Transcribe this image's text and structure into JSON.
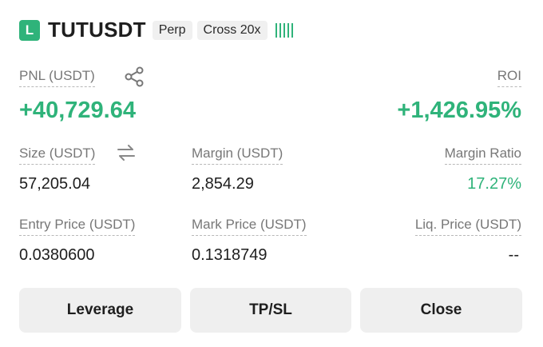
{
  "header": {
    "badge": "L",
    "symbol": "TUTUSDT",
    "tag_type": "Perp",
    "tag_margin": "Cross 20x"
  },
  "pnl": {
    "label": "PNL (USDT)",
    "value": "+40,729.64"
  },
  "roi": {
    "label": "ROI",
    "value": "+1,426.95%"
  },
  "size": {
    "label": "Size (USDT)",
    "value": "57,205.04"
  },
  "margin": {
    "label": "Margin (USDT)",
    "value": "2,854.29"
  },
  "margin_ratio": {
    "label": "Margin Ratio",
    "value": "17.27%"
  },
  "entry_price": {
    "label": "Entry Price (USDT)",
    "value": "0.0380600"
  },
  "mark_price": {
    "label": "Mark Price (USDT)",
    "value": "0.1318749"
  },
  "liq_price": {
    "label": "Liq. Price (USDT)",
    "value": "--"
  },
  "buttons": {
    "leverage": "Leverage",
    "tpsl": "TP/SL",
    "close": "Close"
  },
  "colors": {
    "accent_green": "#2fb37a",
    "muted_label": "#777777",
    "button_bg": "#efefef"
  },
  "icons": {
    "share": "share-icon",
    "swap": "swap-arrows-icon",
    "signal": "signal-bars-icon"
  }
}
